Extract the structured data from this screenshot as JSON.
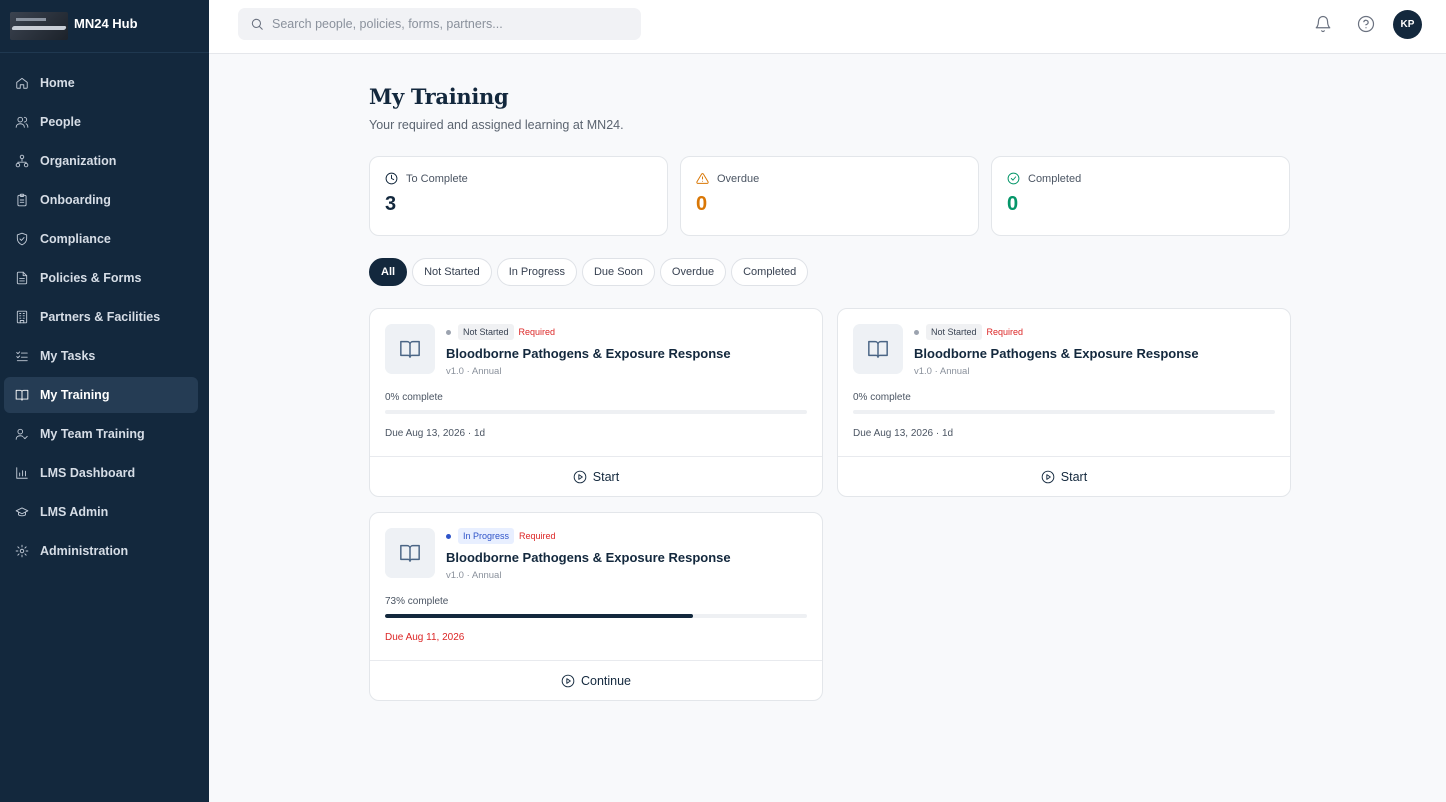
{
  "brand": {
    "name": "MN24 Hub",
    "logo_icon": "company-logo"
  },
  "sidebar": {
    "items": [
      {
        "label": "Home",
        "icon": "home-icon",
        "active": false
      },
      {
        "label": "People",
        "icon": "users-icon",
        "active": false
      },
      {
        "label": "Organization",
        "icon": "org-chart-icon",
        "active": false
      },
      {
        "label": "Onboarding",
        "icon": "clipboard-icon",
        "active": false
      },
      {
        "label": "Compliance",
        "icon": "shield-check-icon",
        "active": false
      },
      {
        "label": "Policies & Forms",
        "icon": "document-icon",
        "active": false
      },
      {
        "label": "Partners & Facilities",
        "icon": "building-icon",
        "active": false
      },
      {
        "label": "My Tasks",
        "icon": "task-list-icon",
        "active": false
      },
      {
        "label": "My Training",
        "icon": "book-open-icon",
        "active": true
      },
      {
        "label": "My Team Training",
        "icon": "team-check-icon",
        "active": false
      },
      {
        "label": "LMS Dashboard",
        "icon": "bar-chart-icon",
        "active": false
      },
      {
        "label": "LMS Admin",
        "icon": "graduation-cap-icon",
        "active": false
      },
      {
        "label": "Administration",
        "icon": "gear-icon",
        "active": false
      }
    ]
  },
  "topbar": {
    "search_placeholder": "Search people, policies, forms, partners...",
    "avatar_initials": "KP"
  },
  "page": {
    "title": "My Training",
    "subtitle": "Your required and assigned learning at MN24."
  },
  "stats": [
    {
      "label": "To Complete",
      "value": "3",
      "icon": "clock-icon",
      "color": "#13283d"
    },
    {
      "label": "Overdue",
      "value": "0",
      "icon": "warning-icon",
      "color": "#d97706"
    },
    {
      "label": "Completed",
      "value": "0",
      "icon": "check-circle-icon",
      "color": "#059669"
    }
  ],
  "filters": [
    "All",
    "Not Started",
    "In Progress",
    "Due Soon",
    "Overdue",
    "Completed"
  ],
  "active_filter": "All",
  "courses": [
    {
      "status": "Not Started",
      "required": "Required",
      "title": "Bloodborne Pathogens & Exposure Response",
      "meta": "v1.0 · Annual",
      "progress_label": "0% complete",
      "progress": 0,
      "due": "Due Aug 13, 2026 · 1d",
      "action": "Start"
    },
    {
      "status": "Not Started",
      "required": "Required",
      "title": "Bloodborne Pathogens & Exposure Response",
      "meta": "v1.0 · Annual",
      "progress_label": "0% complete",
      "progress": 0,
      "due": "Due Aug 13, 2026 · 1d",
      "action": "Start"
    },
    {
      "status": "In Progress",
      "required": "Required",
      "title": "Bloodborne Pathogens & Exposure Response",
      "meta": "v1.0 · Annual",
      "progress_label": "73% complete",
      "progress": 73,
      "due": "Due Aug 11, 2026",
      "action": "Continue"
    }
  ],
  "colors": {
    "sidebar": "#13283d",
    "accent": "#13283d",
    "required": "#dc2626",
    "in_progress": "#2f54c9"
  }
}
